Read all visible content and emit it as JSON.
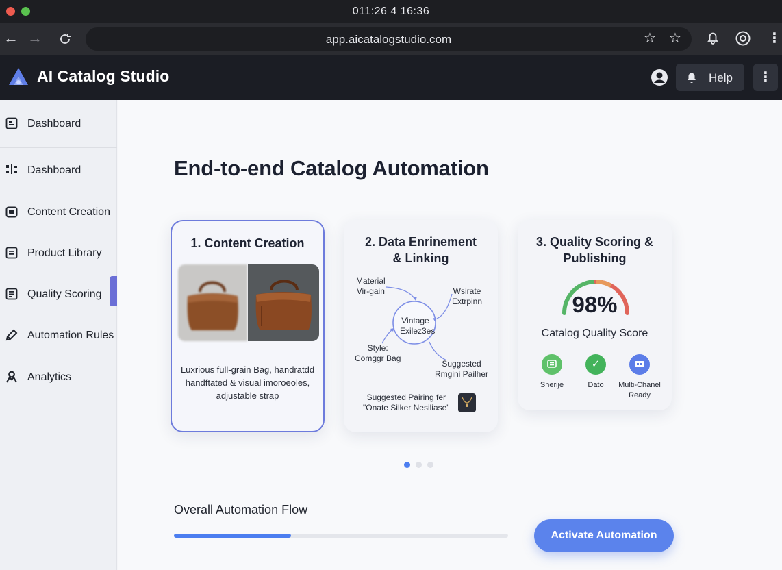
{
  "os": {
    "clock": "011:26 4 16:36"
  },
  "browser": {
    "url": "app.aicatalogstudio.com",
    "icons": [
      "back-arrow-icon",
      "forward-arrow-icon",
      "reload-icon",
      "star-icon",
      "star-icon",
      "bell-icon",
      "settings-circle-icon",
      "more-vertical-icon"
    ]
  },
  "app": {
    "title": "AI Catalog Studio",
    "help_label": "Help",
    "accent": "#5b83ec"
  },
  "sidebar": {
    "top_item": {
      "label": "Dashboard",
      "icon": "dashboard-icon"
    },
    "items": [
      {
        "label": "Dashboard",
        "icon": "grid-icon"
      },
      {
        "label": "Content Creation",
        "icon": "image-icon"
      },
      {
        "label": "Product Library",
        "icon": "list-icon"
      },
      {
        "label": "Quality Scoring",
        "icon": "checklist-icon",
        "active": true
      },
      {
        "label": "Automation Rules",
        "icon": "pen-icon"
      },
      {
        "label": "Analytics",
        "icon": "user-icon"
      }
    ]
  },
  "main": {
    "heading": "End-to-end Catalog Automation",
    "cards": [
      {
        "title": "1. Content Creation",
        "description": "Luxrious full-grain Bag, handratdd handftated & visual imoroeoles, adjustable strap"
      },
      {
        "title_line1": "2. Data Enrinement",
        "title_line2": "& Linking",
        "node_center_line1": "Vintage",
        "node_center_line2": "Exilez3es",
        "node_tl_line1": "Material",
        "node_tl_line2": "Vir-gain",
        "node_tr_line1": "Wsirate",
        "node_tr_line2": "Extrpinn",
        "node_bl_line1": "Style:",
        "node_bl_line2": "Comggr Bag",
        "node_br_line1": "Suggested",
        "node_br_line2": "Rmgini Pailher",
        "pairing_line1": "Suggested Pairing fer",
        "pairing_line2": "\"Onate Silker Nesiliase\""
      },
      {
        "title_line1": "3. Quality Scoring &",
        "title_line2": "Publishing",
        "score": "98%",
        "score_value": 98,
        "score_label": "Catalog Quality Score",
        "badges": [
          {
            "label": "Sherije",
            "icon": "chat-icon",
            "color": "#5fc16a"
          },
          {
            "label": "Dato",
            "icon": "check-icon",
            "color": "#43b35b"
          },
          {
            "label_line1": "Multi-Chanel",
            "label_line2": "Ready",
            "icon": "channels-icon",
            "color": "#5c7de8"
          }
        ]
      }
    ],
    "carousel": {
      "active_index": 0,
      "count": 3
    },
    "flow": {
      "label": "Overall Automation Flow",
      "progress": 0.35
    },
    "activate_label": "Activate Automation"
  }
}
